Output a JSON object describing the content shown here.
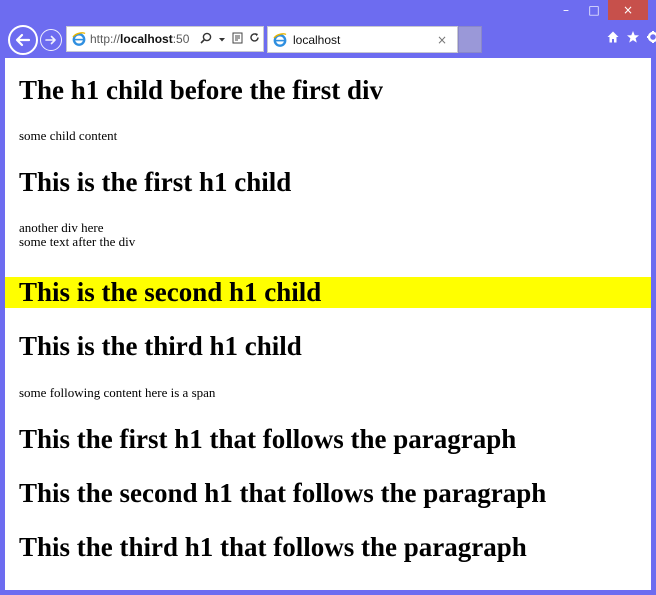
{
  "browser": {
    "url_prefix": "http://",
    "url_host": "localhost",
    "url_port_fragment": ":50",
    "tab_title": "localhost",
    "tab_close_label": "×",
    "window_controls": {
      "minimize": "–",
      "maximize": "□",
      "close": "×"
    }
  },
  "page": {
    "heading_before_div": "The h1 child before the first div",
    "child_content": "some child content",
    "first_h1_child": "This is the first h1 child",
    "another_div": "another div here",
    "text_after_div": "some text after the div",
    "second_h1_child": "This is the second h1 child",
    "third_h1_child": "This is the third h1 child",
    "following_content": "some following content here is a span",
    "first_after_paragraph": "This the first h1 that follows the paragraph",
    "second_after_paragraph": "This the second h1 that follows the paragraph",
    "third_after_paragraph": "This the third h1 that follows the paragraph"
  },
  "colors": {
    "window_frame": "#6d6cf0",
    "highlight": "#ffff00",
    "close_button": "#c7504b"
  },
  "icons": [
    "back-arrow-icon",
    "forward-arrow-icon",
    "ie-logo-icon",
    "search-icon",
    "dropdown-icon",
    "compat-view-icon",
    "refresh-icon",
    "home-icon",
    "favorites-star-icon",
    "settings-gear-icon"
  ]
}
